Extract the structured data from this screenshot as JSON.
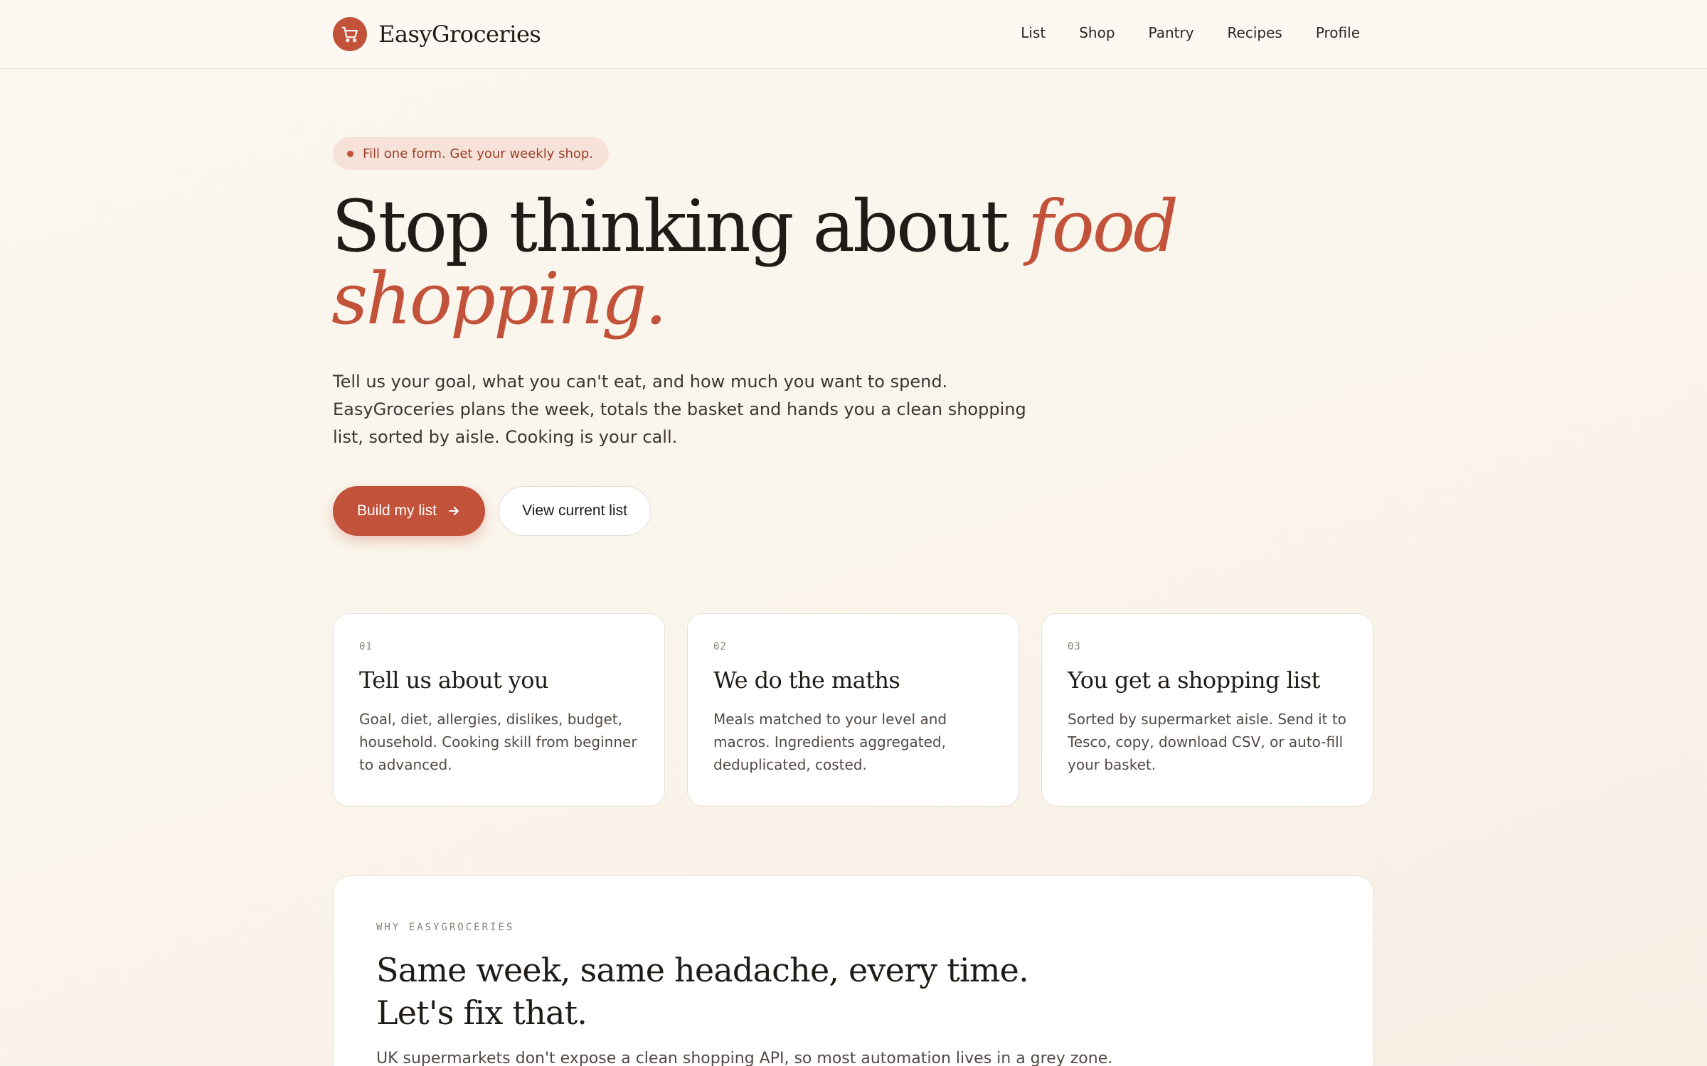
{
  "header": {
    "brand": "EasyGroceries",
    "nav": [
      "List",
      "Shop",
      "Pantry",
      "Recipes",
      "Profile"
    ]
  },
  "hero": {
    "pill": "Fill one form. Get your weekly shop.",
    "title_plain": "Stop thinking about ",
    "title_accent": "food shopping.",
    "subtitle": "Tell us your goal, what you can't eat, and how much you want to spend. EasyGroceries plans the week, totals the basket and hands you a clean shopping list, sorted by aisle. Cooking is your call.",
    "primary_cta": "Build my list",
    "secondary_cta": "View current list"
  },
  "steps": [
    {
      "num": "01",
      "title": "Tell us about you",
      "body": "Goal, diet, allergies, dislikes, budget, household. Cooking skill from beginner to advanced."
    },
    {
      "num": "02",
      "title": "We do the maths",
      "body": "Meals matched to your level and macros. Ingredients aggregated, deduplicated, costed."
    },
    {
      "num": "03",
      "title": "You get a shopping list",
      "body": "Sorted by supermarket aisle. Send it to Tesco, copy, download CSV, or auto-fill your basket."
    }
  ],
  "why": {
    "kicker": "WHY EASYGROCERIES",
    "title": "Same week, same headache, every time. Let's fix that.",
    "body": "UK supermarkets don't expose a clean shopping API, so most automation lives in a grey zone."
  },
  "colors": {
    "accent": "#c2523a",
    "background": "#faf5ec"
  },
  "icons": {
    "brand_logo": "cart-icon",
    "primary_cta": "arrow-right-icon"
  }
}
